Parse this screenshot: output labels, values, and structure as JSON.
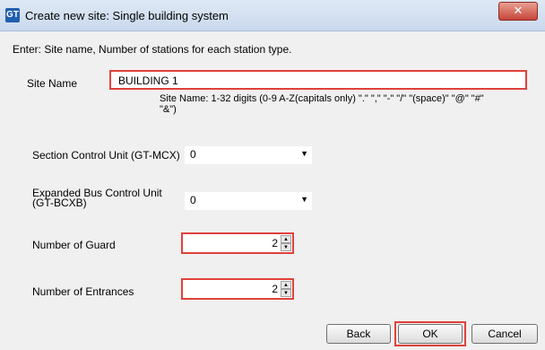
{
  "window": {
    "icon_text": "GT",
    "title": "Create new site: Single building system",
    "close_glyph": "✕"
  },
  "instruction": "Enter: Site name, Number of stations for each station type.",
  "site_name": {
    "label": "Site Name",
    "value": "BUILDING 1",
    "hint": "Site Name: 1-32 digits (0-9 A-Z(capitals only) \".\" \",\" \"-\" \"/\" \"(space)\" \"@\" \"#\" \"&\")"
  },
  "section_control": {
    "label": "Section Control Unit (GT-MCX)",
    "value": "0"
  },
  "expanded_bus": {
    "label_line1": "Expanded Bus Control Unit",
    "label_line2": "(GT-BCXB)",
    "value": "0"
  },
  "guard": {
    "label": "Number of Guard",
    "value": "2"
  },
  "entrances": {
    "label": "Number of Entrances",
    "value": "2"
  },
  "buttons": {
    "back": "Back",
    "ok": "OK",
    "cancel": "Cancel"
  },
  "icons": {
    "dropdown": "chevron-down-icon",
    "spin_up": "arrow-up-icon",
    "spin_down": "arrow-down-icon",
    "close": "close-icon"
  },
  "colors": {
    "highlight": "#e0413b",
    "titlebar": "#c9d9ee",
    "close_button": "#c7453a"
  }
}
